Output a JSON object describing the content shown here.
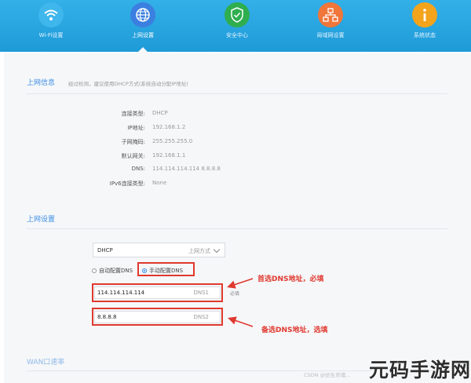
{
  "nav": {
    "items": [
      {
        "label": "Wi-Fi设置",
        "icon": "wifi-icon",
        "color": "#3fb6ec"
      },
      {
        "label": "上网设置",
        "icon": "globe-icon",
        "color": "#3b7fe0",
        "active": true
      },
      {
        "label": "安全中心",
        "icon": "shield-icon",
        "color": "#2fae4f"
      },
      {
        "label": "局域网设置",
        "icon": "network-icon",
        "color": "#f0763a"
      },
      {
        "label": "系统状态",
        "icon": "info-icon",
        "color": "#f3a41c"
      }
    ]
  },
  "internet_info": {
    "title": "上网信息",
    "hint": "经过检测，建议使用DHCP方式(系统自动分配IP地址)",
    "rows": [
      {
        "label": "连接类型:",
        "value": "DHCP"
      },
      {
        "label": "IP地址:",
        "value": "192.168.1.2"
      },
      {
        "label": "子网掩码:",
        "value": "255.255.255.0"
      },
      {
        "label": "默认网关:",
        "value": "192.168.1.1"
      },
      {
        "label": "DNS:",
        "value": "114.114.114.114 8.8.8.8"
      },
      {
        "label": "IPv6连接类型:",
        "value": "None"
      }
    ]
  },
  "internet_settings": {
    "title": "上网设置",
    "mode_select": {
      "value": "DHCP",
      "hint": "上网方式"
    },
    "radio_auto": "自动配置DNS",
    "radio_manual": "手动配置DNS",
    "dns1": {
      "value": "114.114.114.114",
      "tag": "DNS1"
    },
    "dns2": {
      "value": "8.8.8.8",
      "tag": "DNS2"
    },
    "required_label": "必填"
  },
  "annotations": {
    "primary": "首选DNS地址，必填",
    "secondary": "备选DNS地址，选填"
  },
  "wan": {
    "title": "WAN口速率"
  },
  "watermark": {
    "small": "CSDN @仿生灵魂...",
    "big": "元码手游网"
  },
  "colors": {
    "accent": "#3a8ee6",
    "annotation": "#e0392f"
  }
}
